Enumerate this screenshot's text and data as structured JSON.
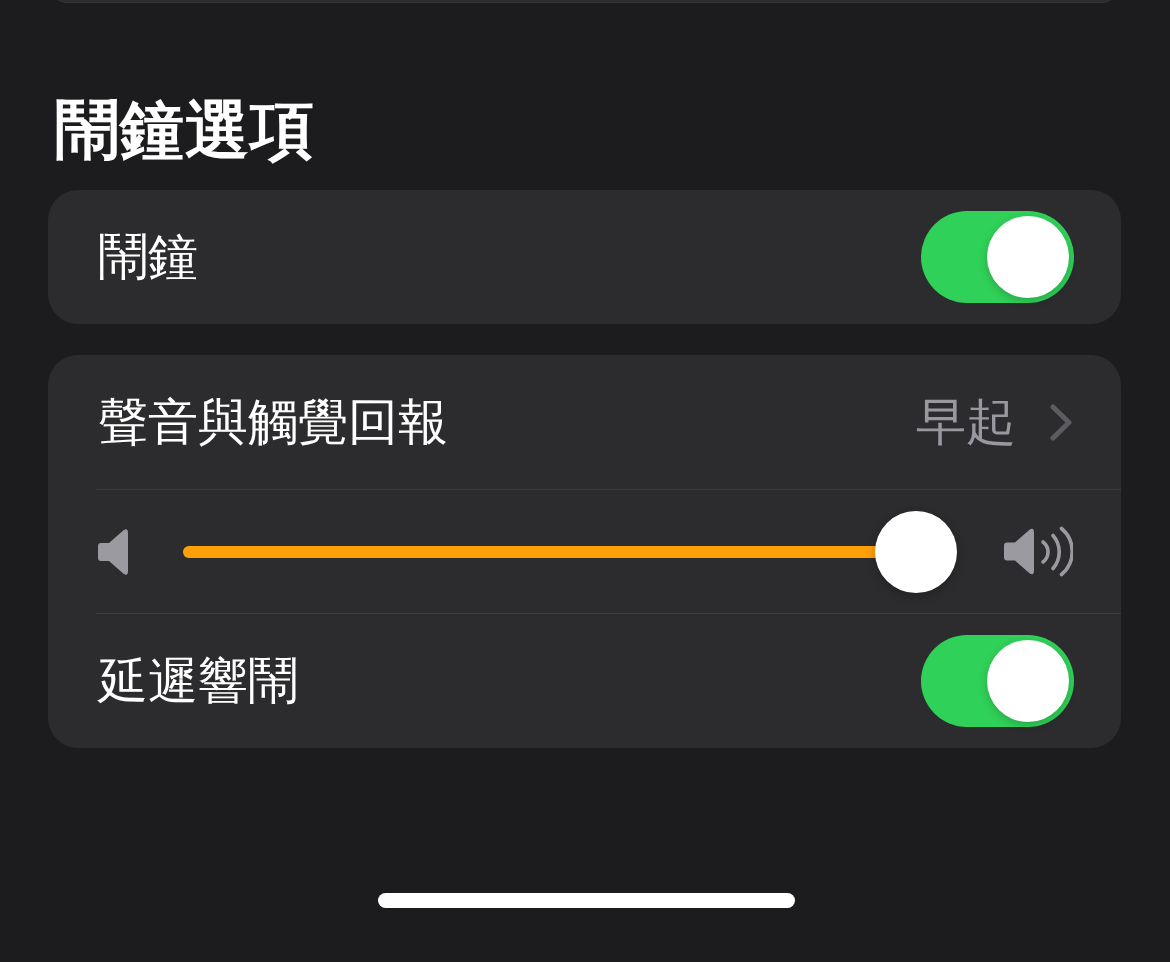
{
  "section": {
    "title": "鬧鐘選項"
  },
  "groups": [
    {
      "rows": [
        {
          "kind": "toggle",
          "label": "鬧鐘",
          "on": true
        }
      ]
    },
    {
      "rows": [
        {
          "kind": "link",
          "label": "聲音與觸覺回報",
          "value": "早起"
        },
        {
          "kind": "slider",
          "level": 1
        },
        {
          "kind": "toggle",
          "label": "延遲響鬧",
          "on": true
        }
      ]
    }
  ]
}
